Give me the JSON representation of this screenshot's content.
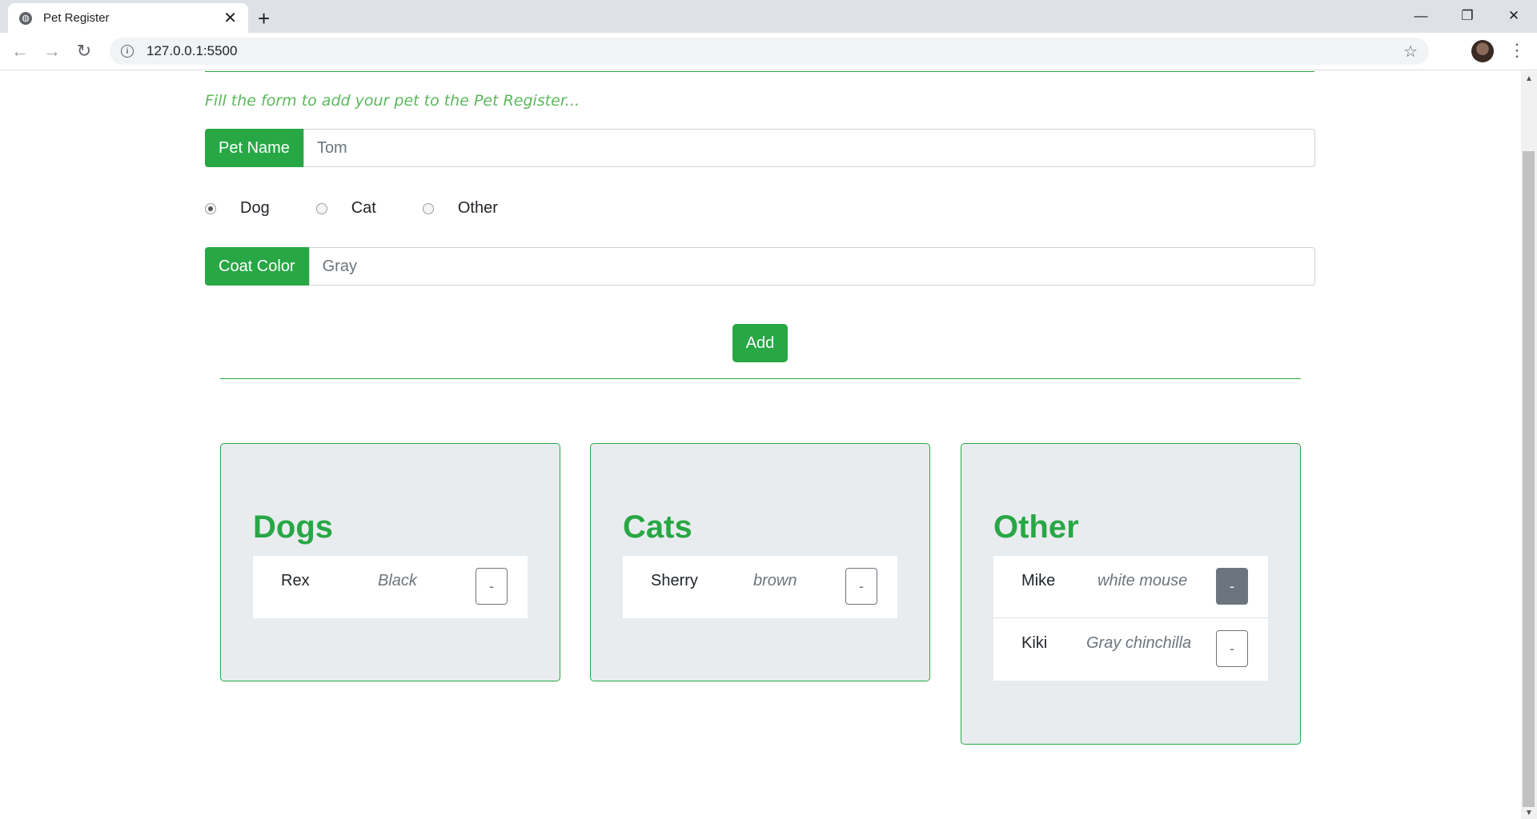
{
  "browser": {
    "tab_title": "Pet Register",
    "url": "127.0.0.1:5500"
  },
  "form": {
    "intro": "Fill the form to add your pet to the Pet Register...",
    "pet_name_label": "Pet Name",
    "pet_name_value": "Tom",
    "type_options": [
      "Dog",
      "Cat",
      "Other"
    ],
    "selected_type": "Dog",
    "coat_color_label": "Coat Color",
    "coat_color_value": "Gray",
    "add_label": "Add"
  },
  "lists": [
    {
      "title": "Dogs",
      "pets": [
        {
          "name": "Rex",
          "color": "Black"
        }
      ]
    },
    {
      "title": "Cats",
      "pets": [
        {
          "name": "Sherry",
          "color": "brown"
        }
      ]
    },
    {
      "title": "Other",
      "pets": [
        {
          "name": "Mike",
          "color": "white mouse"
        },
        {
          "name": "Kiki",
          "color": "Gray chinchilla"
        }
      ]
    }
  ],
  "remove_label": "-",
  "colors": {
    "accent": "#28a745",
    "card_bg": "#e9ecef",
    "button_hover": "#6c757d"
  }
}
